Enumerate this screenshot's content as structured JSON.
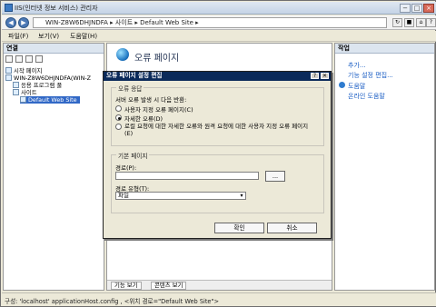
{
  "window": {
    "title": "IIS(인터넷 정보 서비스) 관리자"
  },
  "address": {
    "crumbs": [
      "WIN-Z8W6DHJNDFA",
      "사이트",
      "Default Web Site"
    ]
  },
  "menu": {
    "items": [
      "파일(F)",
      "보기(V)",
      "도움말(H)"
    ]
  },
  "left": {
    "header": "연결",
    "tree": [
      {
        "label": "시작 페이지",
        "level": 0
      },
      {
        "label": "WIN-Z8W6DHJNDFA(WIN-Z",
        "level": 0
      },
      {
        "label": "응용 프로그램 풀",
        "level": 1
      },
      {
        "label": "사이트",
        "level": 1
      },
      {
        "label": "Default Web Site",
        "level": 2,
        "selected": true
      }
    ]
  },
  "center": {
    "title": "오류 페이지",
    "tabs": [
      "기능 보기",
      "콘텐츠 보기"
    ]
  },
  "right": {
    "header": "작업",
    "actions": [
      "추가...",
      "기능 설정 편집...",
      "도움말",
      "온라인 도움말"
    ]
  },
  "status": {
    "text": "구성: 'localhost' applicationHost.config , <위치 경로=\"Default Web Site\">"
  },
  "dialog": {
    "title": "오류 페이지 설정 편집",
    "response_group": "오류 응답",
    "response_prompt": "서버 오류 발생 시 다음 반환:",
    "options": [
      "사용자 지정 오류 페이지(C)",
      "자세한 오류(D)",
      "로컬 요청에 대한 자세한 오류와 원격 요청에 대한 사용자 지정 오류 페이지(E)"
    ],
    "selected_option": 1,
    "default_group": "기본 페이지",
    "path_label": "경로(P):",
    "path_value": "",
    "browse_label": "...",
    "path_type_label": "경로 유형(T):",
    "path_type_value": "파일",
    "ok_label": "확인",
    "cancel_label": "취소",
    "help_button": "?",
    "close_button": "✕"
  },
  "colors": {
    "selection": "#3168c6",
    "title": "#0b2a5a",
    "link": "#1a5dc4"
  }
}
